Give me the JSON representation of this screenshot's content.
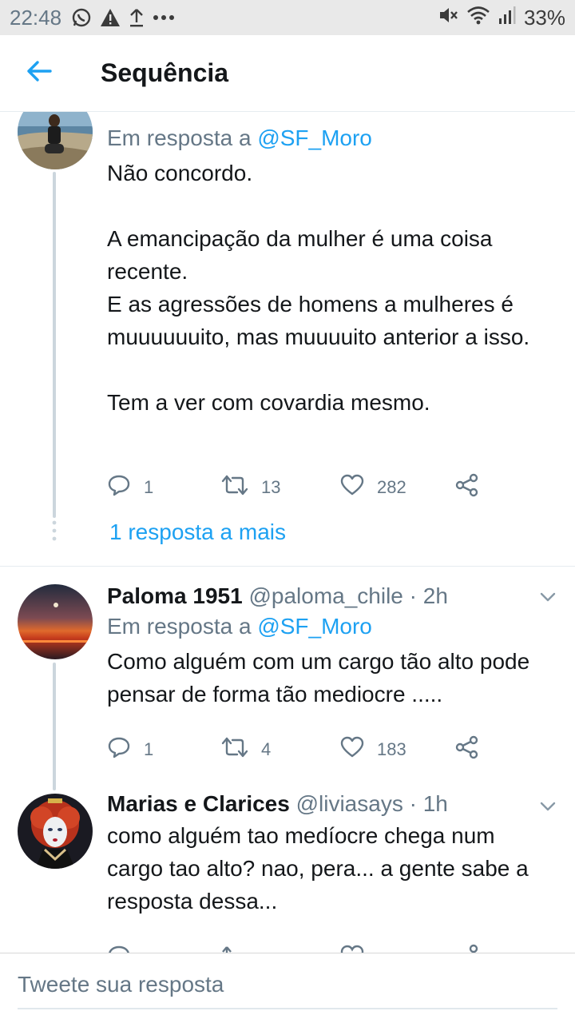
{
  "status_bar": {
    "time": "22:48",
    "battery": "33%",
    "icons": [
      "whatsapp-icon",
      "warning-icon",
      "upload-icon",
      "more-icon",
      "mute-icon",
      "wifi-icon",
      "signal-icon"
    ]
  },
  "header": {
    "title": "Sequência",
    "back_icon": "arrow-left-icon"
  },
  "colors": {
    "accent": "#1da1f2",
    "secondary_text": "#657786",
    "primary_text": "#14171a",
    "thread_line": "#ccd6dd"
  },
  "tweets": [
    {
      "reply_prefix": "Em resposta a",
      "reply_to": "@SF_Moro",
      "text_lines": [
        "Não concordo.",
        "",
        "A emancipação da mulher é uma coisa recente.",
        "E as agressões de homens a mulheres é muuuuuuito, mas muuuuito anterior a isso.",
        "",
        "Tem a ver com covardia mesmo."
      ],
      "replies": "1",
      "retweets": "13",
      "likes": "282",
      "more_replies": "1 resposta a mais"
    },
    {
      "name": "Paloma 1951",
      "handle": "@paloma_chile",
      "dot": "·",
      "time": "2h",
      "reply_prefix": "Em resposta a",
      "reply_to": "@SF_Moro",
      "text_lines": [
        "Como alguém com um cargo tão alto pode pensar de forma tão mediocre ....."
      ],
      "replies": "1",
      "retweets": "4",
      "likes": "183"
    },
    {
      "name": "Marias e Clarices",
      "handle": "@liviasays",
      "dot": "·",
      "time": "1h",
      "text_lines": [
        "como alguém tao medíocre chega num cargo tao alto? nao, pera... a gente sabe a resposta dessa..."
      ]
    }
  ],
  "compose": {
    "placeholder": "Tweete sua resposta"
  }
}
